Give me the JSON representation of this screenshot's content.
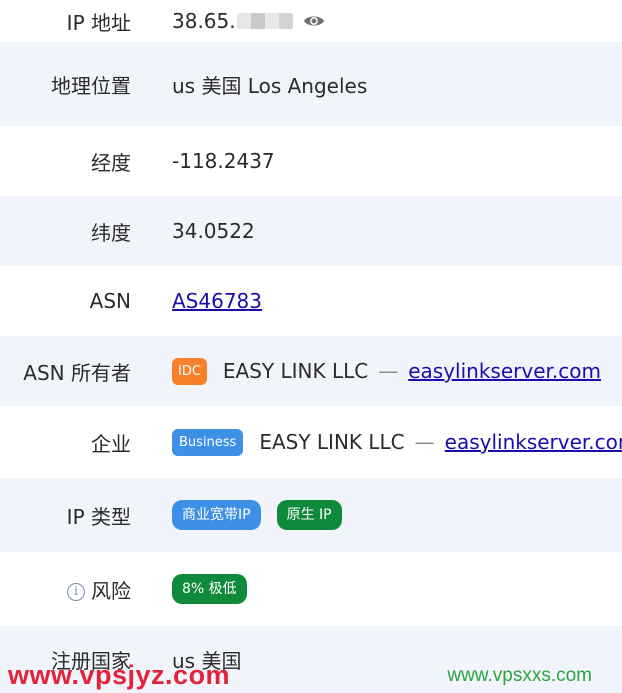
{
  "rows": {
    "ip": {
      "label": "IP 地址",
      "value_prefix": "38.65."
    },
    "location": {
      "label": "地理位置",
      "value": "us 美国 Los Angeles"
    },
    "longitude": {
      "label": "经度",
      "value": "-118.2437"
    },
    "latitude": {
      "label": "纬度",
      "value": "34.0522"
    },
    "asn": {
      "label": "ASN",
      "value": "AS46783"
    },
    "asn_owner": {
      "label": "ASN 所有者",
      "badge": "IDC",
      "name": "EASY LINK LLC",
      "dash": "—",
      "domain": "easylinkserver.com"
    },
    "enterprise": {
      "label": "企业",
      "badge": "Business",
      "name": "EASY LINK LLC",
      "dash": "—",
      "domain": "easylinkserver.com"
    },
    "ip_type": {
      "label": "IP 类型",
      "tags": [
        "商业宽带IP",
        "原生 IP"
      ]
    },
    "risk": {
      "label": "风险",
      "info_glyph": "i",
      "tag": "8% 极低"
    },
    "reg_country": {
      "label": "注册国家",
      "value": "us 美国"
    }
  },
  "watermarks": {
    "left": "www.vpsjyz.com",
    "right": "www.vpsxxs.com"
  },
  "icons": {
    "ip": "eye-icon",
    "risk": "info-icon"
  },
  "colors": {
    "idc": "#f7812b",
    "business": "#3d8fe8",
    "green_tag": "#0f8a3b",
    "link": "#1a0dab",
    "row_alt": "#f1f5fb"
  }
}
